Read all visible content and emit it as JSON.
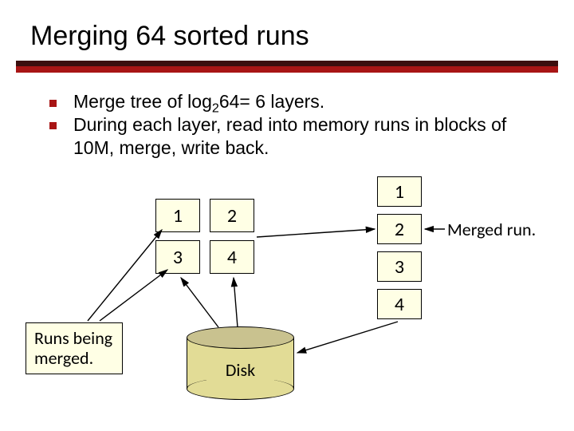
{
  "title": "Merging 64 sorted runs",
  "bullets": {
    "b1_pre": "Merge tree of log",
    "b1_sub": "2",
    "b1_post": "64= 6 layers.",
    "b2": "During each layer, read into memory runs in blocks of 10M, merge, write back."
  },
  "grid": {
    "c1": "1",
    "c2": "2",
    "c3": "3",
    "c4": "4"
  },
  "merged": {
    "m1": "1",
    "m2": "2",
    "m3": "3",
    "m4": "4"
  },
  "labels": {
    "runs": "Runs being merged.",
    "merged_run": "Merged run.",
    "disk": "Disk"
  }
}
